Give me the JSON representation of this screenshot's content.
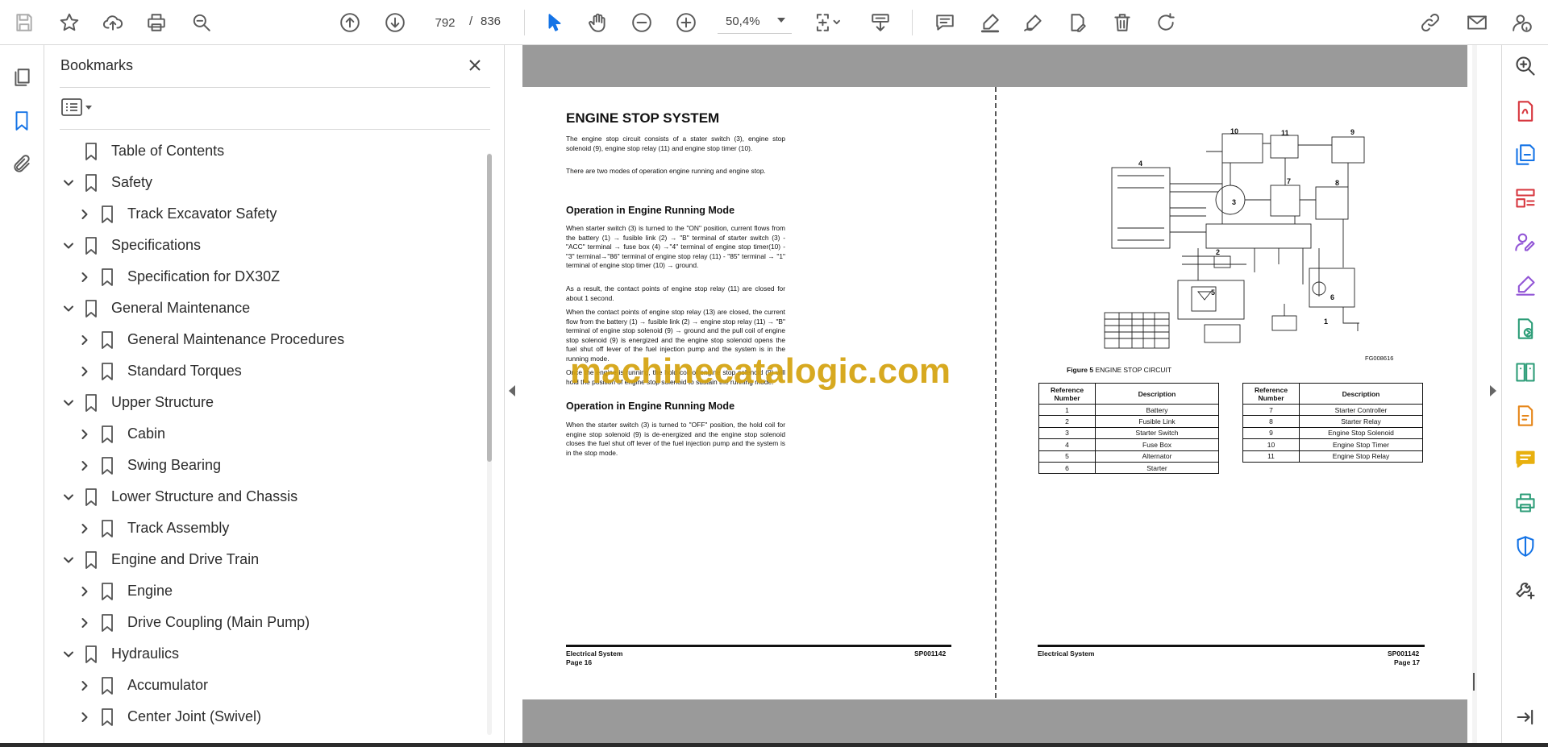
{
  "toolbar": {
    "page_current": "792",
    "page_separator": "/",
    "page_total": "836",
    "zoom": "50,4%"
  },
  "bookmarks": {
    "title": "Bookmarks",
    "items": [
      {
        "label": "Table of Contents",
        "level": 0,
        "expandable": false
      },
      {
        "label": "Safety",
        "level": 0,
        "expandable": true,
        "expanded": true
      },
      {
        "label": "Track Excavator Safety",
        "level": 1,
        "expandable": true,
        "expanded": false
      },
      {
        "label": "Specifications",
        "level": 0,
        "expandable": true,
        "expanded": true
      },
      {
        "label": "Specification for DX30Z",
        "level": 1,
        "expandable": true,
        "expanded": false
      },
      {
        "label": "General Maintenance",
        "level": 0,
        "expandable": true,
        "expanded": true
      },
      {
        "label": "General Maintenance Procedures",
        "level": 1,
        "expandable": true,
        "expanded": false
      },
      {
        "label": "Standard Torques",
        "level": 1,
        "expandable": true,
        "expanded": false
      },
      {
        "label": "Upper Structure",
        "level": 0,
        "expandable": true,
        "expanded": true
      },
      {
        "label": "Cabin",
        "level": 1,
        "expandable": true,
        "expanded": false
      },
      {
        "label": "Swing Bearing",
        "level": 1,
        "expandable": true,
        "expanded": false
      },
      {
        "label": "Lower Structure and Chassis",
        "level": 0,
        "expandable": true,
        "expanded": true
      },
      {
        "label": "Track Assembly",
        "level": 1,
        "expandable": true,
        "expanded": false
      },
      {
        "label": "Engine and Drive Train",
        "level": 0,
        "expandable": true,
        "expanded": true
      },
      {
        "label": "Engine",
        "level": 1,
        "expandable": true,
        "expanded": false
      },
      {
        "label": "Drive Coupling (Main Pump)",
        "level": 1,
        "expandable": true,
        "expanded": false
      },
      {
        "label": "Hydraulics",
        "level": 0,
        "expandable": true,
        "expanded": true
      },
      {
        "label": "Accumulator",
        "level": 1,
        "expandable": true,
        "expanded": false
      },
      {
        "label": "Center Joint (Swivel)",
        "level": 1,
        "expandable": true,
        "expanded": false
      }
    ]
  },
  "document": {
    "left_page": {
      "title": "ENGINE STOP SYSTEM",
      "intro_1": "The engine stop circuit consists of a stater switch (3), engine stop solenoid (9), engine stop relay (11) and engine stop timer (10).",
      "intro_2": "There are two modes of operation engine running and engine stop.",
      "heading_1": "Operation in Engine Running Mode",
      "running_1": "When starter switch (3) is turned to the \"ON\" position, current flows from the battery (1) → fusible link (2) → \"B\" terminal of starter switch (3) - \"ACC\" terminal → fuse box (4) →\"4\" terminal of engine stop timer(10) - \"3\" terminal→\"86\" terminal of engine stop relay (11) - \"85\" terminal → \"1\" terminal of engine stop timer (10) → ground.",
      "running_2": "As a result, the contact points of engine stop relay (11) are closed for about 1 second.",
      "running_3": "When the contact points of engine stop relay (13) are closed, the current flow from the battery (1) → fusible link (2) → engine stop relay (11) → \"B\" terminal of engine stop solenoid (9) → ground and the pull coil of engine stop solenoid (9) is energized and the engine stop solenoid opens the fuel shut off lever of the fuel injection pump and the system is in the running mode.",
      "running_4": "Once the engine is running, the hold coil of engine stop solenoid (9) will hold the position of engine stop solenoid to sustain the running mode.",
      "heading_2": "Operation in Engine Running Mode",
      "stop_1": "When the starter switch (3) is turned to \"OFF\" position, the hold coil for engine stop solenoid (9) is de-energized and the engine stop solenoid closes the fuel shut off lever of the fuel injection pump and the system is in the stop mode.",
      "footer_left": "Electrical System",
      "footer_page": "Page 16",
      "footer_code": "SP001142"
    },
    "right_page": {
      "figure_code": "FG008616",
      "figure_caption_bold": "Figure 5",
      "figure_caption": "ENGINE STOP CIRCUIT",
      "table_header_ref": "Reference Number",
      "table_header_desc": "Description",
      "table_left": [
        {
          "num": "1",
          "desc": "Battery"
        },
        {
          "num": "2",
          "desc": "Fusible Link"
        },
        {
          "num": "3",
          "desc": "Starter Switch"
        },
        {
          "num": "4",
          "desc": "Fuse Box"
        },
        {
          "num": "5",
          "desc": "Alternator"
        },
        {
          "num": "6",
          "desc": "Starter"
        }
      ],
      "table_right": [
        {
          "num": "7",
          "desc": "Starter Controller"
        },
        {
          "num": "8",
          "desc": "Starter Relay"
        },
        {
          "num": "9",
          "desc": "Engine Stop Solenoid"
        },
        {
          "num": "10",
          "desc": "Engine Stop Timer"
        },
        {
          "num": "11",
          "desc": "Engine Stop Relay"
        }
      ],
      "circuit_labels": [
        "10",
        "11",
        "9",
        "4",
        "3",
        "7",
        "8",
        "2",
        "5",
        "1",
        "6"
      ],
      "footer_left": "Electrical System",
      "footer_page": "Page 17",
      "footer_code": "SP001142"
    },
    "watermark": "machinecatalogic.com"
  },
  "colors": {
    "accent": "#1473e6",
    "watermark": "#d4a20e",
    "tool_pink": "#d7373f",
    "tool_blue": "#1473e6",
    "tool_purple": "#9255d6",
    "tool_green": "#2d9d78",
    "tool_orange": "#e68619",
    "tool_yellow": "#e8b00f"
  }
}
